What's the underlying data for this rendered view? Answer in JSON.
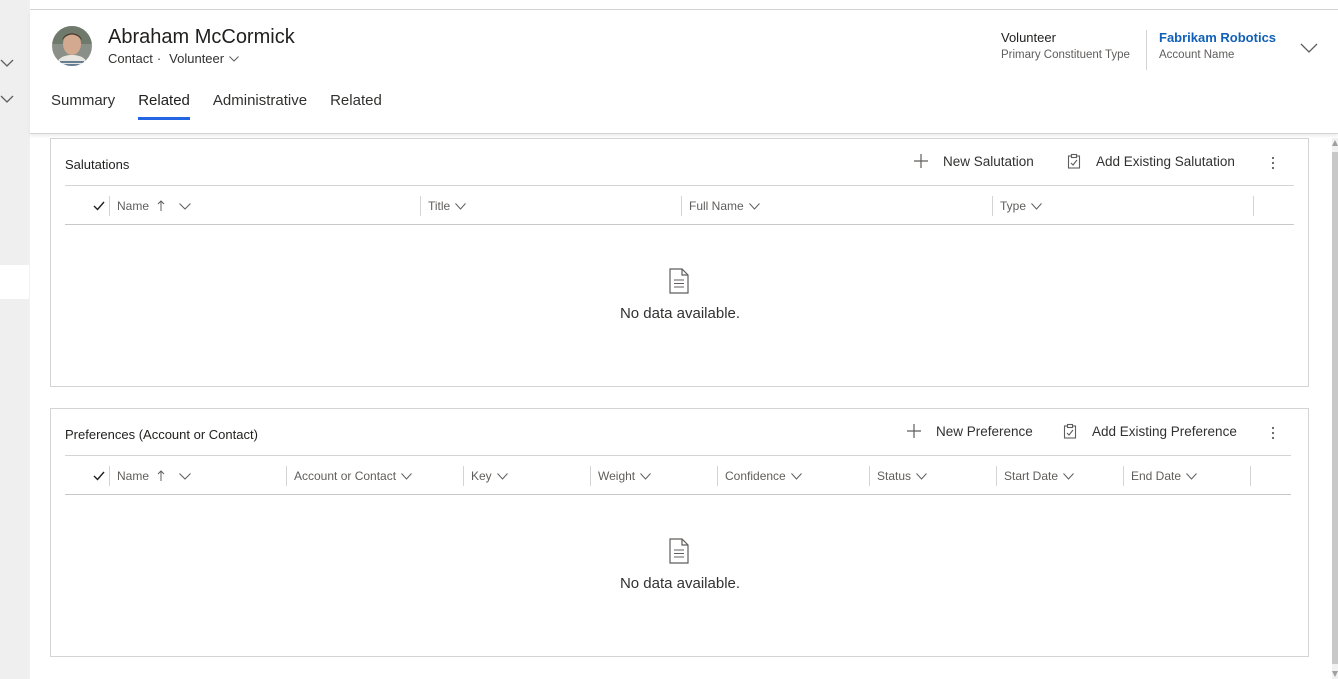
{
  "record": {
    "name": "Abraham McCormick",
    "entity": "Contact",
    "separator": "·",
    "form": "Volunteer"
  },
  "header_fields": [
    {
      "value": "Volunteer",
      "label": "Primary Constituent Type"
    },
    {
      "value": "Fabrikam Robotics",
      "label": "Account Name"
    }
  ],
  "tabs": [
    {
      "label": "Summary",
      "active": false
    },
    {
      "label": "Related",
      "active": true
    },
    {
      "label": "Administrative",
      "active": false
    },
    {
      "label": "Related",
      "active": false
    }
  ],
  "salutations": {
    "title": "Salutations",
    "new_label": "New Salutation",
    "add_existing_label": "Add Existing Salutation",
    "columns": [
      "Name",
      "Title",
      "Full Name",
      "Type"
    ],
    "empty_text": "No data available."
  },
  "preferences": {
    "title": "Preferences (Account or Contact)",
    "new_label": "New Preference",
    "add_existing_label": "Add Existing Preference",
    "columns": [
      "Name",
      "Account or Contact",
      "Key",
      "Weight",
      "Confidence",
      "Status",
      "Start Date",
      "End Date"
    ],
    "empty_text": "No data available."
  },
  "colors": {
    "accent": "#2266e3",
    "link": "#1160b7",
    "border": "#d4d4d4"
  },
  "icons": [
    "chevron-down-icon",
    "add-icon",
    "clipboard-icon",
    "more-icon",
    "checkmark-icon",
    "sort-ascending-icon",
    "document-icon"
  ]
}
